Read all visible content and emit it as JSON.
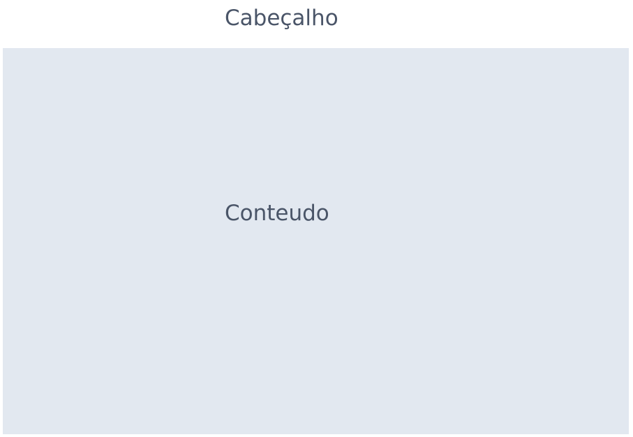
{
  "header": {
    "title": "Cabeçalho"
  },
  "content": {
    "label": "Conteudo"
  },
  "colors": {
    "header_background": "#ffffff",
    "content_background": "#e2e8f0",
    "text": "#4a5568"
  }
}
